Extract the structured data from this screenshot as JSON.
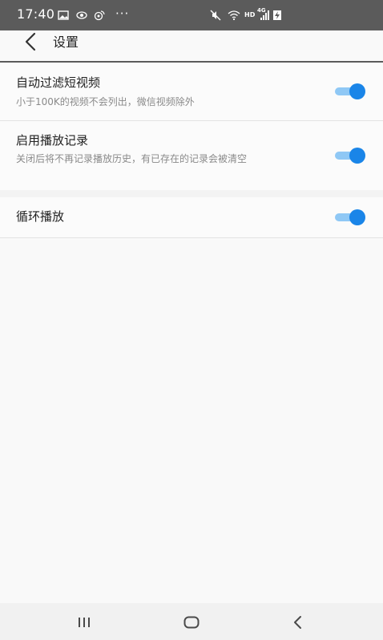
{
  "status_bar": {
    "time": "17:40",
    "more_indicator": "···",
    "network_label": "HD",
    "network_type": "4G",
    "icons": [
      "image-icon",
      "eye-icon",
      "weibo-icon",
      "mute-icon",
      "wifi-icon",
      "signal-icon",
      "battery-charging-icon"
    ]
  },
  "header": {
    "title": "设置",
    "back_icon": "chevron-left-icon"
  },
  "settings": [
    {
      "title": "自动过滤短视频",
      "description": "小于100K的视频不会列出，微信视频除外",
      "enabled": true
    },
    {
      "title": "启用播放记录",
      "description": "关闭后将不再记录播放历史，有已存在的记录会被清空",
      "enabled": true
    },
    {
      "title": "循环播放",
      "enabled": true
    }
  ],
  "nav_bar": {
    "icons": [
      "recent-apps-icon",
      "home-icon",
      "back-icon"
    ]
  },
  "colors": {
    "accent": "#1a85e8",
    "toggle_track": "#8fc8f5",
    "status_bar": "#5b5b5b",
    "background": "#f9f9f9"
  }
}
